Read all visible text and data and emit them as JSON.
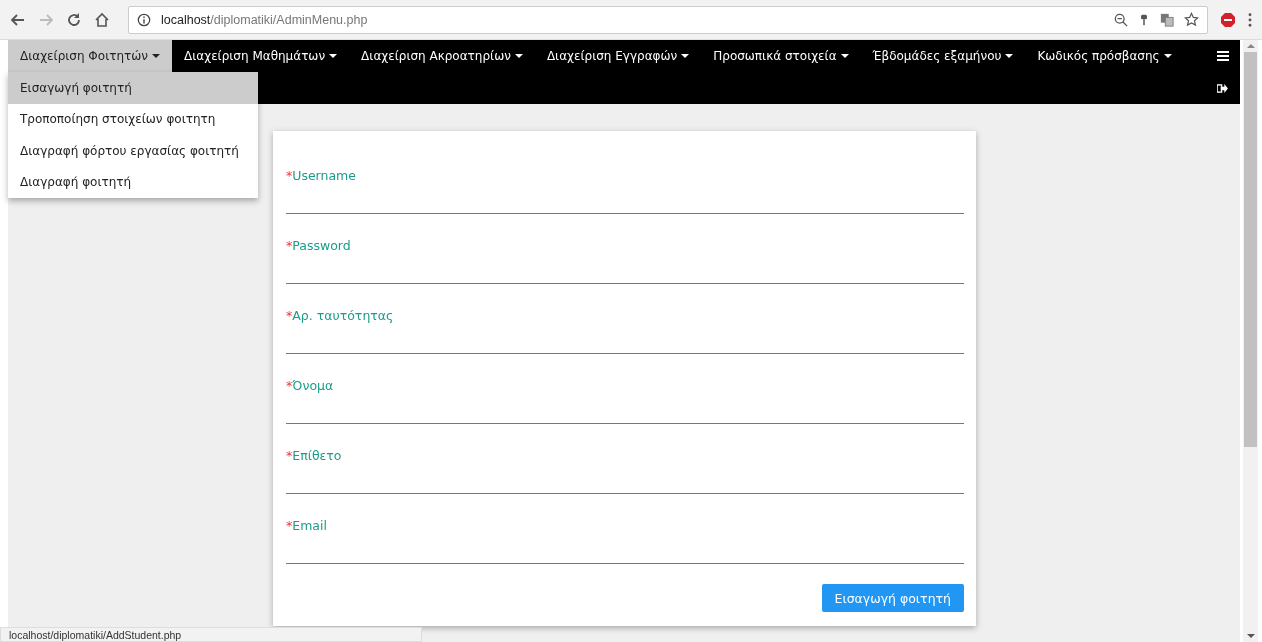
{
  "browser": {
    "url_host": "localhost",
    "url_path": "/diplomatiki/AdminMenu.php"
  },
  "nav": {
    "items": [
      {
        "label": "Διαχείριση Φοιτητών",
        "selected": true
      },
      {
        "label": "Διαχείριση Μαθημάτων",
        "selected": false
      },
      {
        "label": "Διαχείριση Ακροατηρίων",
        "selected": false
      },
      {
        "label": "Διαχείριση Εγγραφών",
        "selected": false
      },
      {
        "label": "Προσωπικά στοιχεία",
        "selected": false
      },
      {
        "label": "Έβδομάδες εξαμήνου",
        "selected": false
      },
      {
        "label": "Κωδικός πρόσβασης",
        "selected": false
      }
    ]
  },
  "dropdown": {
    "items": [
      {
        "label": "Εισαγωγή φοιτητή",
        "selected": true
      },
      {
        "label": "Τροποποίηση στοιχείων φοιτητη",
        "selected": false
      },
      {
        "label": "Διαγραφή φόρτου εργασίας φοιτητή",
        "selected": false
      },
      {
        "label": "Διαγραφή φοιτητή",
        "selected": false
      }
    ]
  },
  "form": {
    "fields": [
      {
        "mark": "*",
        "label": "Username"
      },
      {
        "mark": "*",
        "label": "Password"
      },
      {
        "mark": "*",
        "label": "Αρ. ταυτότητας"
      },
      {
        "mark": "*",
        "label": "Όνομα"
      },
      {
        "mark": "*",
        "label": "Επίθετο"
      },
      {
        "mark": "*",
        "label": "Email"
      }
    ],
    "submit": "Εισαγωγή φοιτητή"
  },
  "status_bar": "localhost/diplomatiki/AddStudent.php"
}
